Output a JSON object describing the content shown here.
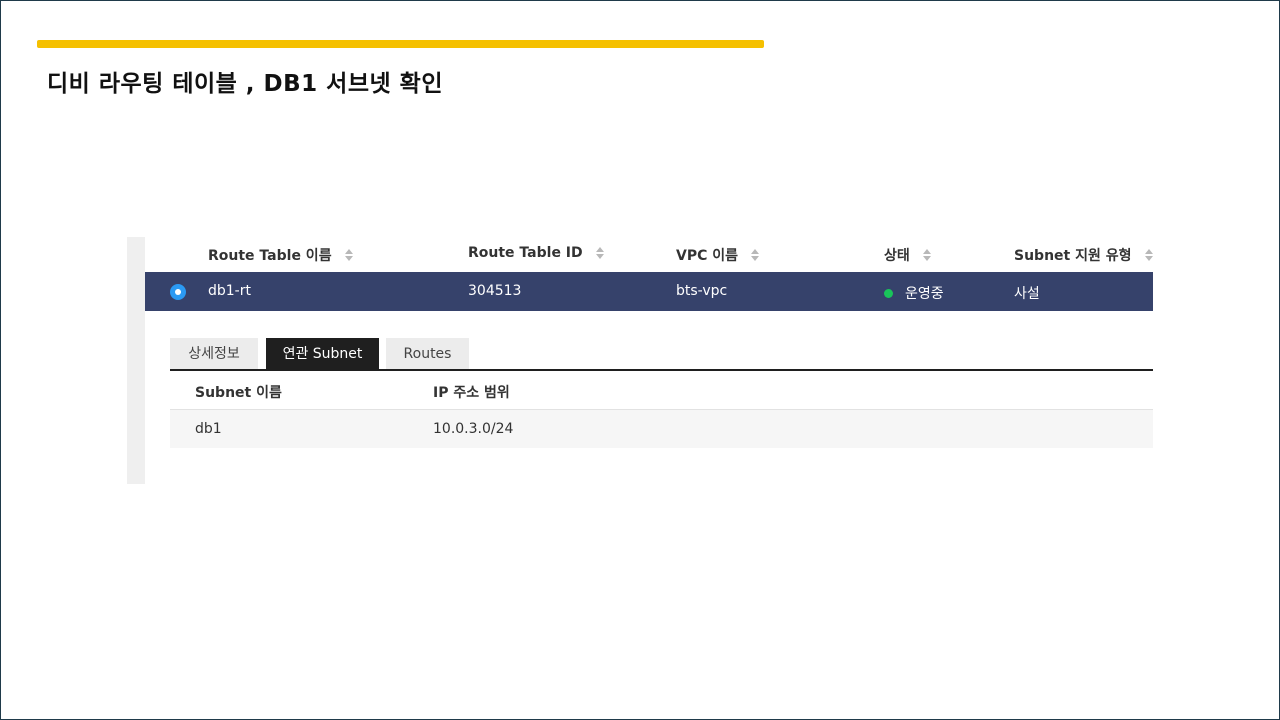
{
  "slide": {
    "title": "디비 라우팅 테이블 , DB1 서브넷 확인",
    "accent_color": "#f5c000"
  },
  "route_table": {
    "columns": [
      {
        "label": "Route Table 이름",
        "sortable": true
      },
      {
        "label": "Route Table ID",
        "sortable": true
      },
      {
        "label": "VPC 이름",
        "sortable": true
      },
      {
        "label": "상태",
        "sortable": true
      },
      {
        "label": "Subnet 지원 유형",
        "sortable": true
      }
    ],
    "rows": [
      {
        "selected": true,
        "name": "db1-rt",
        "id": "304513",
        "vpc": "bts-vpc",
        "status": "운영중",
        "status_color": "#19c45a",
        "subnet_type": "사설"
      }
    ],
    "selected_row_color": "#36426b"
  },
  "detail_tabs": [
    {
      "label": "상세정보",
      "active": false
    },
    {
      "label": "연관 Subnet",
      "active": true
    },
    {
      "label": "Routes",
      "active": false
    }
  ],
  "subnet_table": {
    "columns": [
      "Subnet 이름",
      "IP 주소 범위"
    ],
    "rows": [
      {
        "name": "db1",
        "ip_range": "10.0.3.0/24"
      }
    ]
  }
}
